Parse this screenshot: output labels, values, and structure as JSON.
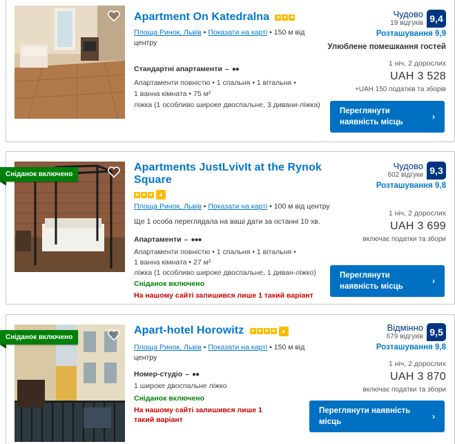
{
  "listings": [
    {
      "title": "Apartment On Katedralna",
      "stars": 3,
      "preferred": false,
      "ribbon": "",
      "area_link": "Площа Ринок, Львів",
      "map_link": "Показати на карті",
      "distance": "150 м від центру",
      "notice": "",
      "room_type": "Стандартні апартаменти",
      "room_dash": "–",
      "occupancy_icon": "two-person-icon",
      "desc_lines": [
        "Апартаменти повністю • 1 спальня • 1 вітальня •",
        "1 ванна кімната • 75 м²",
        "ліжка (1 особливо широке двоспальне, 3 дивани-ліжка)"
      ],
      "breakfast": "",
      "scarcity": "",
      "verdict": "Чудово",
      "reviews": "19 відгуків",
      "score": "9,4",
      "location_score": "Розташування 9,9",
      "favourite": "Улюблене помешкання гостей",
      "nights": "1 ніч, 2 дорослих",
      "price": "UAH 3 528",
      "taxes": "+UAH 150 податків та зборів",
      "button": "Переглянути наявність місць"
    },
    {
      "title": "Apartments JustLvivIt at the Rynok Square",
      "stars": 3,
      "preferred": true,
      "ribbon": "Сніданок включено",
      "area_link": "Площа Ринок, Львів",
      "map_link": "Показати на карті",
      "distance": "100 м від центру",
      "notice": "Ще 1 особа переглядала на ваші дати за останні 10 хв.",
      "room_type": "Апартаменти",
      "room_dash": "–",
      "occupancy_icon": "three-person-icon",
      "desc_lines": [
        "Апартаменти повністю • 1 спальня • 1 вітальня •",
        "1 ванна кімната • 27 м²",
        "ліжка (1 особливо широке двоспальне, 1 диван-ліжко)"
      ],
      "breakfast": "Сніданок включено",
      "scarcity": "На нашому сайті залишився лише 1 такий варіант",
      "verdict": "Чудово",
      "reviews": "602 відгуки",
      "score": "9,3",
      "location_score": "Розташування 9,8",
      "favourite": "",
      "nights": "1 ніч, 2 дорослих",
      "price": "UAH 3 699",
      "taxes": "включає податки та збори",
      "button": "Переглянути наявність місць"
    },
    {
      "title": "Apart-hotel Horowitz",
      "stars": 4,
      "preferred": true,
      "ribbon": "Сніданок включено",
      "area_link": "Площа Ринок, Львів",
      "map_link": "Показати на карті",
      "distance": "150 м від центру",
      "notice": "",
      "room_type": "Номер-студіо",
      "room_dash": "–",
      "occupancy_icon": "two-person-icon",
      "desc_lines": [
        "1 широке двоспальне ліжко"
      ],
      "breakfast": "Сніданок включено",
      "scarcity": "На нашому сайті залишився лише 1 такий варіант",
      "verdict": "Відмінно",
      "reviews": "679 відгуків",
      "score": "9,5",
      "location_score": "Розташування 9,8",
      "favourite": "",
      "nights": "1 ніч, 2 дорослих",
      "price": "UAH 3 870",
      "taxes": "включає податки та збори",
      "button": "Переглянути наявність місць"
    }
  ],
  "colors": {
    "link": "#0077cc",
    "score_bg": "#003580",
    "button_bg": "#0071c2",
    "ribbon_bg": "#008009",
    "star": "#febb02",
    "scarcity": "#cc0000"
  }
}
